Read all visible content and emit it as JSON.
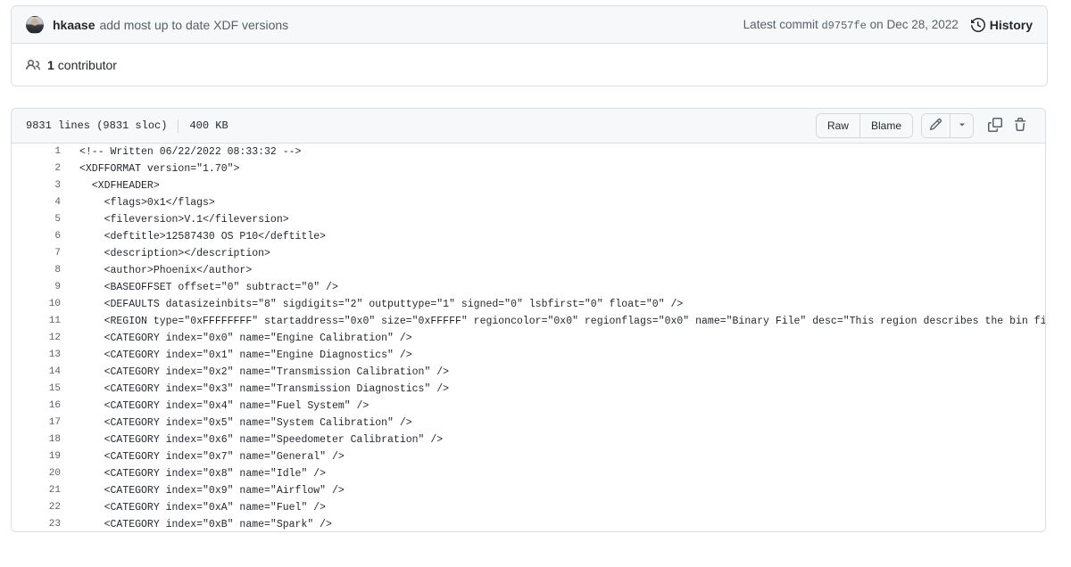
{
  "commit": {
    "author": "hkaase",
    "message": "add most up to date XDF versions",
    "latest_label": "Latest commit",
    "sha": "d9757fe",
    "date_prefix": "on",
    "date": "Dec 28, 2022",
    "history_label": "History",
    "avatar_name": "user-avatar"
  },
  "contributors": {
    "count": "1",
    "label": "contributor"
  },
  "file": {
    "lines": "9831 lines (9831 sloc)",
    "size": "400 KB",
    "raw_label": "Raw",
    "blame_label": "Blame"
  },
  "code": {
    "lines": [
      {
        "n": "1",
        "text": "<!-- Written 06/22/2022 08:33:32 -->"
      },
      {
        "n": "2",
        "text": "<XDFFORMAT version=\"1.70\">"
      },
      {
        "n": "3",
        "text": "  <XDFHEADER>"
      },
      {
        "n": "4",
        "text": "    <flags>0x1</flags>"
      },
      {
        "n": "5",
        "text": "    <fileversion>V.1</fileversion>"
      },
      {
        "n": "6",
        "text": "    <deftitle>12587430 OS P10</deftitle>"
      },
      {
        "n": "7",
        "text": "    <description></description>"
      },
      {
        "n": "8",
        "text": "    <author>Phoenix</author>"
      },
      {
        "n": "9",
        "text": "    <BASEOFFSET offset=\"0\" subtract=\"0\" />"
      },
      {
        "n": "10",
        "text": "    <DEFAULTS datasizeinbits=\"8\" sigdigits=\"2\" outputtype=\"1\" signed=\"0\" lsbfirst=\"0\" float=\"0\" />"
      },
      {
        "n": "11",
        "text": "    <REGION type=\"0xFFFFFFFF\" startaddress=\"0x0\" size=\"0xFFFFF\" regioncolor=\"0x0\" regionflags=\"0x0\" name=\"Binary File\" desc=\"This region describes the bin file edited by this"
      },
      {
        "n": "12",
        "text": "    <CATEGORY index=\"0x0\" name=\"Engine Calibration\" />"
      },
      {
        "n": "13",
        "text": "    <CATEGORY index=\"0x1\" name=\"Engine Diagnostics\" />"
      },
      {
        "n": "14",
        "text": "    <CATEGORY index=\"0x2\" name=\"Transmission Calibration\" />"
      },
      {
        "n": "15",
        "text": "    <CATEGORY index=\"0x3\" name=\"Transmission Diagnostics\" />"
      },
      {
        "n": "16",
        "text": "    <CATEGORY index=\"0x4\" name=\"Fuel System\" />"
      },
      {
        "n": "17",
        "text": "    <CATEGORY index=\"0x5\" name=\"System Calibration\" />"
      },
      {
        "n": "18",
        "text": "    <CATEGORY index=\"0x6\" name=\"Speedometer Calibration\" />"
      },
      {
        "n": "19",
        "text": "    <CATEGORY index=\"0x7\" name=\"General\" />"
      },
      {
        "n": "20",
        "text": "    <CATEGORY index=\"0x8\" name=\"Idle\" />"
      },
      {
        "n": "21",
        "text": "    <CATEGORY index=\"0x9\" name=\"Airflow\" />"
      },
      {
        "n": "22",
        "text": "    <CATEGORY index=\"0xA\" name=\"Fuel\" />"
      },
      {
        "n": "23",
        "text": "    <CATEGORY index=\"0xB\" name=\"Spark\" />"
      }
    ]
  },
  "colors": {
    "border": "#d8dee4",
    "toolbar_bg": "#f6f8fa",
    "text": "#24292f",
    "muted": "#57606a"
  }
}
